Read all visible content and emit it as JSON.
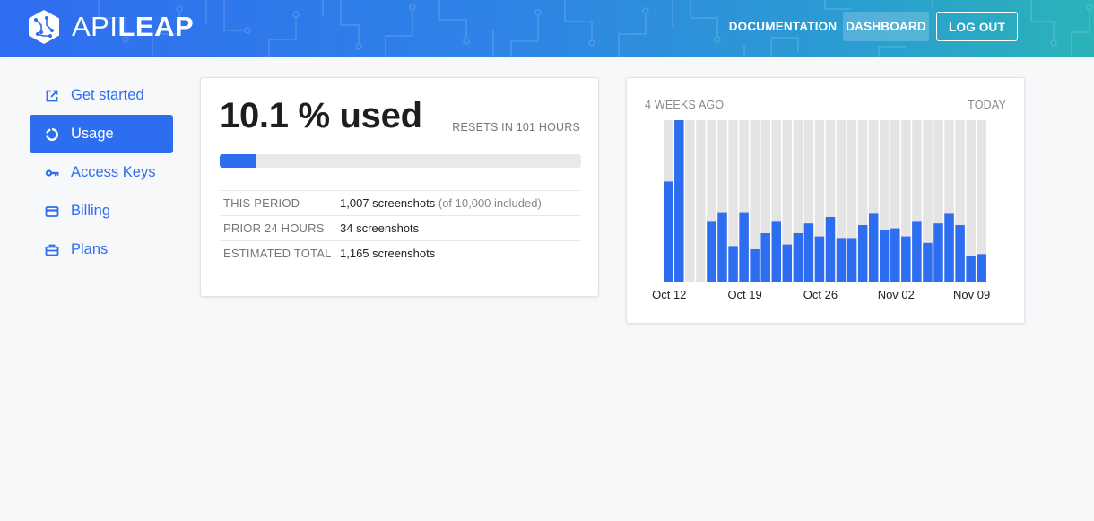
{
  "brand": {
    "name_thin": "API",
    "name_bold": "LEAP"
  },
  "nav": {
    "documentation": "DOCUMENTATION",
    "dashboard": "DASHBOARD",
    "logout": "LOG OUT"
  },
  "sidebar": {
    "items": [
      {
        "label": "Get started",
        "icon": "external-link-icon"
      },
      {
        "label": "Usage",
        "icon": "donut-chart-icon",
        "active": true
      },
      {
        "label": "Access Keys",
        "icon": "key-icon"
      },
      {
        "label": "Billing",
        "icon": "credit-card-icon"
      },
      {
        "label": "Plans",
        "icon": "briefcase-icon"
      }
    ]
  },
  "usage": {
    "title": "10.1 % used",
    "resets": "RESETS IN 101 HOURS",
    "progress_percent": 10.1,
    "rows": [
      {
        "label": "THIS PERIOD",
        "value": "1,007 screenshots",
        "note": "(of 10,000 included)"
      },
      {
        "label": "PRIOR 24 HOURS",
        "value": "34 screenshots",
        "note": ""
      },
      {
        "label": "ESTIMATED TOTAL",
        "value": "1,165 screenshots",
        "note": ""
      }
    ]
  },
  "colors": {
    "accent": "#2d6ef0",
    "bar_bg": "#e4e4e4"
  },
  "chart_data": {
    "type": "bar",
    "left_label": "4 WEEKS AGO",
    "right_label": "TODAY",
    "x_ticks": [
      {
        "label": "Oct 12",
        "index": 0
      },
      {
        "label": "Oct 19",
        "index": 7
      },
      {
        "label": "Oct 26",
        "index": 14
      },
      {
        "label": "Nov 02",
        "index": 21
      },
      {
        "label": "Nov 09",
        "index": 28
      }
    ],
    "ymax": 100,
    "values": [
      62,
      100,
      0,
      0,
      37,
      43,
      22,
      43,
      20,
      30,
      37,
      23,
      30,
      36,
      28,
      40,
      27,
      27,
      35,
      42,
      32,
      33,
      28,
      37,
      24,
      36,
      42,
      35,
      16,
      17
    ]
  }
}
